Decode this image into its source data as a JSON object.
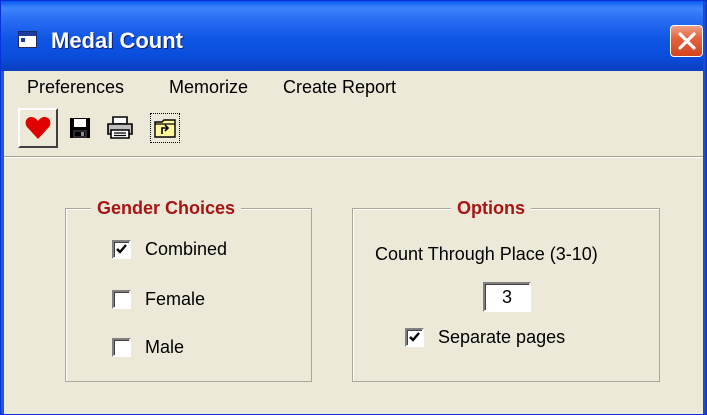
{
  "window": {
    "title": "Medal Count"
  },
  "menu": [
    {
      "label": "Preferences"
    },
    {
      "label": "Memorize"
    },
    {
      "label": "Create Report"
    }
  ],
  "toolbar": {
    "buttons": [
      {
        "icon": "heart-icon",
        "color": "#E00000"
      },
      {
        "icon": "save-icon"
      },
      {
        "icon": "print-icon"
      },
      {
        "icon": "folder-up-icon"
      }
    ]
  },
  "gender_choices": {
    "title": "Gender Choices",
    "options": [
      {
        "label": "Combined",
        "checked": true
      },
      {
        "label": "Female",
        "checked": false
      },
      {
        "label": "Male",
        "checked": false
      }
    ]
  },
  "options": {
    "title": "Options",
    "count_label": "Count Through Place (3-10)",
    "count_value": "3",
    "separate_pages": {
      "label": "Separate pages",
      "checked": true
    }
  },
  "colors": {
    "title_bar": "#0A4DDB",
    "group_title": "#A81414",
    "face": "#ECE9D8"
  }
}
